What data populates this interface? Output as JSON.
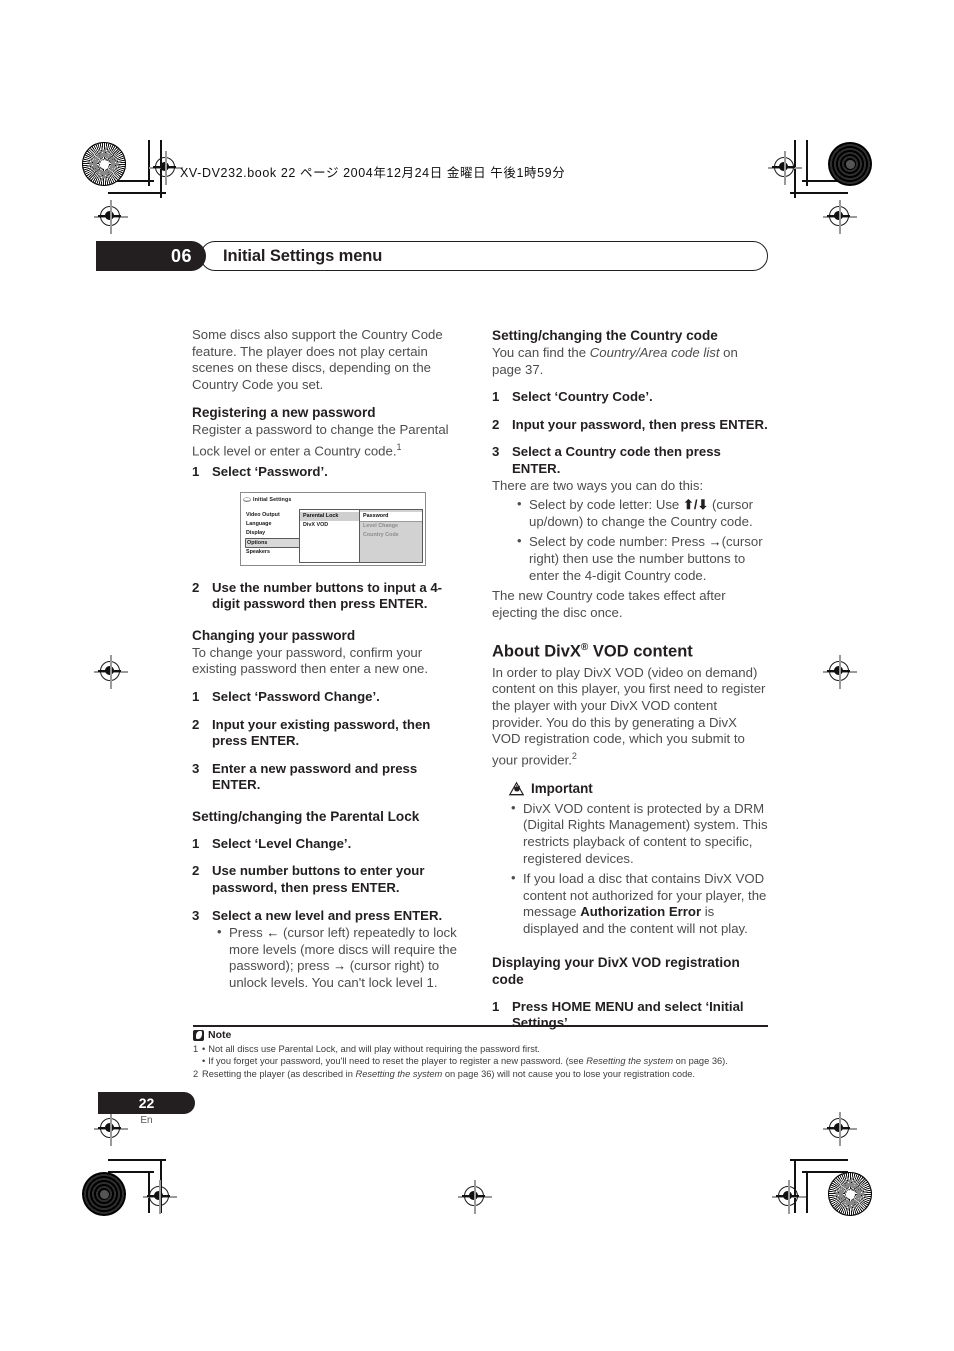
{
  "running_head": "XV-DV232.book 22 ページ 2004年12月24日 金曜日 午後1時59分",
  "chapter": {
    "number": "06",
    "title": "Initial Settings menu"
  },
  "left_column": {
    "intro": "Some discs also support the Country Code feature. The player does not play certain scenes on these discs, depending on the Country Code you set.",
    "registering": {
      "heading": "Registering a new password",
      "body": "Register a password to change the Parental Lock level or enter a Country code.",
      "body_superscript": "1",
      "step1_num": "1",
      "step1_text": "Select ‘Password’.",
      "step2_num": "2",
      "step2_text": "Use the number buttons to input a 4-digit password then press ENTER."
    },
    "osd": {
      "title": "Initial Settings",
      "menu_items": [
        "Video Output",
        "Language",
        "Display",
        "Options",
        "Speakers"
      ],
      "selected_menu_item": "Options",
      "panel1_items": [
        "Parental Lock",
        "DivX VOD"
      ],
      "panel1_selected": "Parental Lock",
      "panel2_items": [
        "Password",
        "Level Change",
        "Country Code"
      ],
      "panel2_selected": "Password",
      "panel2_dim_items": [
        "Level Change",
        "Country Code"
      ]
    },
    "changing": {
      "heading": "Changing your password",
      "body": "To change your password, confirm your existing password then enter a new one.",
      "step1_num": "1",
      "step1_text": "Select ‘Password Change’.",
      "step2_num": "2",
      "step2_text": "Input your existing password, then press ENTER.",
      "step3_num": "3",
      "step3_text": "Enter a new password and press ENTER."
    },
    "parental": {
      "heading": "Setting/changing the Parental Lock",
      "step1_num": "1",
      "step1_text": "Select ‘Level Change’.",
      "step2_num": "2",
      "step2_text": "Use number buttons to enter your password, then press ENTER.",
      "step3_num": "3",
      "step3_text": "Select a new level and press ENTER.",
      "bullet1_pre": "Press ",
      "bullet1_arrow_left": "←",
      "bullet1_mid": " (cursor left) repeatedly to lock more levels (more discs will require the password); press ",
      "bullet1_arrow_right": "→",
      "bullet1_post": " (cursor right) to unlock levels. You can't lock level 1."
    }
  },
  "right_column": {
    "country": {
      "heading": "Setting/changing the Country code",
      "body_pre": "You can find the ",
      "body_italic": "Country/Area code list",
      "body_post": " on page 37.",
      "step1_num": "1",
      "step1_text": "Select ‘Country Code’.",
      "step2_num": "2",
      "step2_text": "Input your password, then press ENTER.",
      "step3_num": "3",
      "step3_text": "Select a Country code then press ENTER.",
      "after_step3": "There are two ways you can do this:",
      "bullet1_pre": "Select by code letter: Use ",
      "bullet1_arrows": "⬆/⬇",
      "bullet1_post": " (cursor up/down) to change the Country code.",
      "bullet2_pre": "Select by code number: Press ",
      "bullet2_arrow": "→",
      "bullet2_post": "(cursor right) then use the number buttons to enter the 4-digit Country code.",
      "closing": "The new Country code takes effect after ejecting the disc once."
    },
    "divx": {
      "heading_pre": "About DivX",
      "heading_sup": "®",
      "heading_post": " VOD content",
      "body": "In order to play DivX VOD (video on demand) content on this player, you first need to register the player with your DivX VOD content provider. You do this by generating a DivX VOD registration code, which you submit to your provider.",
      "body_superscript": "2",
      "important_label": "Important",
      "important_bullet1": "DivX VOD content is protected by a DRM (Digital Rights Management) system. This restricts playback of content to specific, registered devices.",
      "important_bullet2_pre": "If you load a disc that contains DivX VOD content not authorized for your player, the message ",
      "important_bullet2_bold": "Authorization Error",
      "important_bullet2_post": " is displayed and the content will not play."
    },
    "displaying": {
      "heading": "Displaying your DivX VOD registration code",
      "step1_num": "1",
      "step1_text": "Press HOME MENU and select ‘Initial Settings’."
    }
  },
  "footer": {
    "note_label": "Note",
    "note1_marker": "1",
    "note1_text": "Not all discs use Parental Lock, and will play without requiring the password first.",
    "note1b_pre": "If you forget your password, you'll need to reset the player to register a new password. (see ",
    "note1b_italic": "Resetting the system",
    "note1b_post": " on page 36).",
    "note2_marker": "2",
    "note2_pre": "Resetting the player (as described in ",
    "note2_italic": "Resetting the system",
    "note2_post": " on page 36) will not cause you to lose your registration code.",
    "page_number": "22",
    "page_language": "En"
  }
}
